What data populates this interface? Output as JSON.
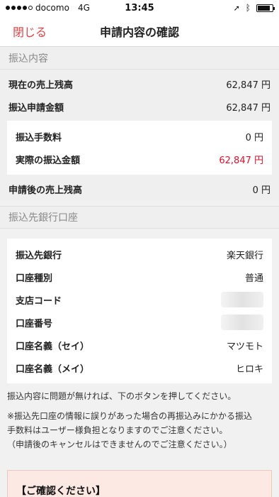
{
  "status_bar": {
    "carrier": "docomo",
    "network": "4G",
    "time": "13:45",
    "battery_level": 0.85,
    "icons": [
      "location-arrow-icon",
      "bluetooth-icon",
      "battery-icon"
    ]
  },
  "nav": {
    "close_label": "閉じる",
    "title": "申請内容の確認"
  },
  "transfer_section": {
    "header": "振込内容",
    "rows": [
      {
        "label": "現在の売上残高",
        "value": "62,847 円"
      },
      {
        "label": "振込申請金額",
        "value": "62,847 円"
      }
    ],
    "detail_rows": [
      {
        "label": "振込手数料",
        "value": "0 円"
      },
      {
        "label": "実際の振込金額",
        "value": "62,847 円"
      }
    ],
    "after_row": {
      "label": "申請後の売上残高",
      "value": "0 円"
    }
  },
  "bank_section": {
    "header": "振込先銀行口座",
    "rows": [
      {
        "label": "振込先銀行",
        "value": "楽天銀行"
      },
      {
        "label": "口座種別",
        "value": "普通"
      },
      {
        "label": "支店コード",
        "value": ""
      },
      {
        "label": "口座番号",
        "value": ""
      },
      {
        "label": "口座名義（セイ）",
        "value": "マツモト"
      },
      {
        "label": "口座名義（メイ）",
        "value": "ヒロキ"
      }
    ]
  },
  "notes": {
    "instruction": "振込内容に問題が無ければ、下のボタンを押してください。",
    "warning_line1": "※振込先口座の情報に誤りがあった場合の再振込みにかかる振込",
    "warning_line2": "手数料はユーザー様負担となりますのでご注意ください。",
    "warning_line3": "（申請後のキャンセルはできませんのでご注意ください。）"
  },
  "confirm_box": {
    "title": "【ご確認ください】"
  },
  "colors": {
    "accent_red": "#e04446",
    "amount_red": "#e0112b"
  }
}
